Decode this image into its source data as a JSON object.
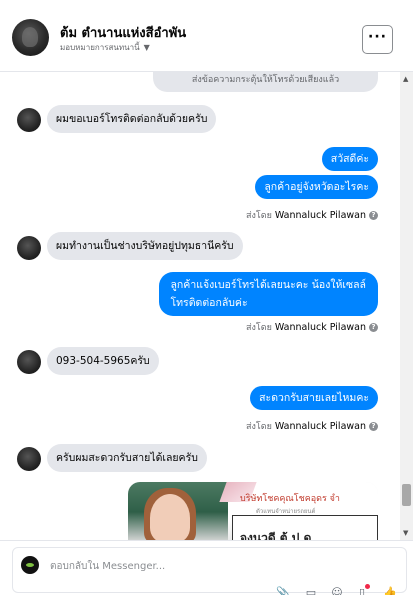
{
  "header": {
    "name": "ต้ม ตำนานแห่งสีอำพัน",
    "subtitle": "มอบหมายการสนทนานี้",
    "more_label": "···"
  },
  "messages": {
    "top_note": "ส่งข้อความกระตุ้นให้โทรด้วยเสียงแล้ว",
    "in1": "ผมขอเบอร์โทรติดต่อกลับด้วยครับ",
    "out1": "สวัสดีค่ะ",
    "out2": "ลูกค้าอยู่จังหวัดอะไรคะ",
    "in2": "ผมทำงานเป็นช่างบริษัทอยู่ปทุมธานีครับ",
    "out3_line1": "ลูกค้าแจ้งเบอร์โทรได้เลยนะคะ  น้องให้เซลล์",
    "out3_line2": "โทรติดต่อกลับค่ะ",
    "in3": "093-504-5965ครับ",
    "out4": "สะดวกรับสายเลยไหมคะ",
    "in4": "ครับผมสะดวกรับสายได้เลยครับ"
  },
  "sent_by": {
    "prefix": "ส่งโดย",
    "name": "Wannaluck Pilawan",
    "help_icon": "?"
  },
  "image_card": {
    "title": "บริษัทโชคคุณโชคอุดร จำ",
    "small": "ตัวแทนจำหน่ายรถยนต์",
    "box_text": "จงนวดี ตู้ ป ด"
  },
  "composer": {
    "placeholder": "ตอบกลับใน Messenger..."
  },
  "icons": {
    "attach": "📎",
    "gif": "▭",
    "emoji": "☺",
    "sticker": "▯",
    "like": "👍"
  },
  "colors": {
    "outgoing": "#0084ff",
    "incoming": "#e4e6eb"
  }
}
